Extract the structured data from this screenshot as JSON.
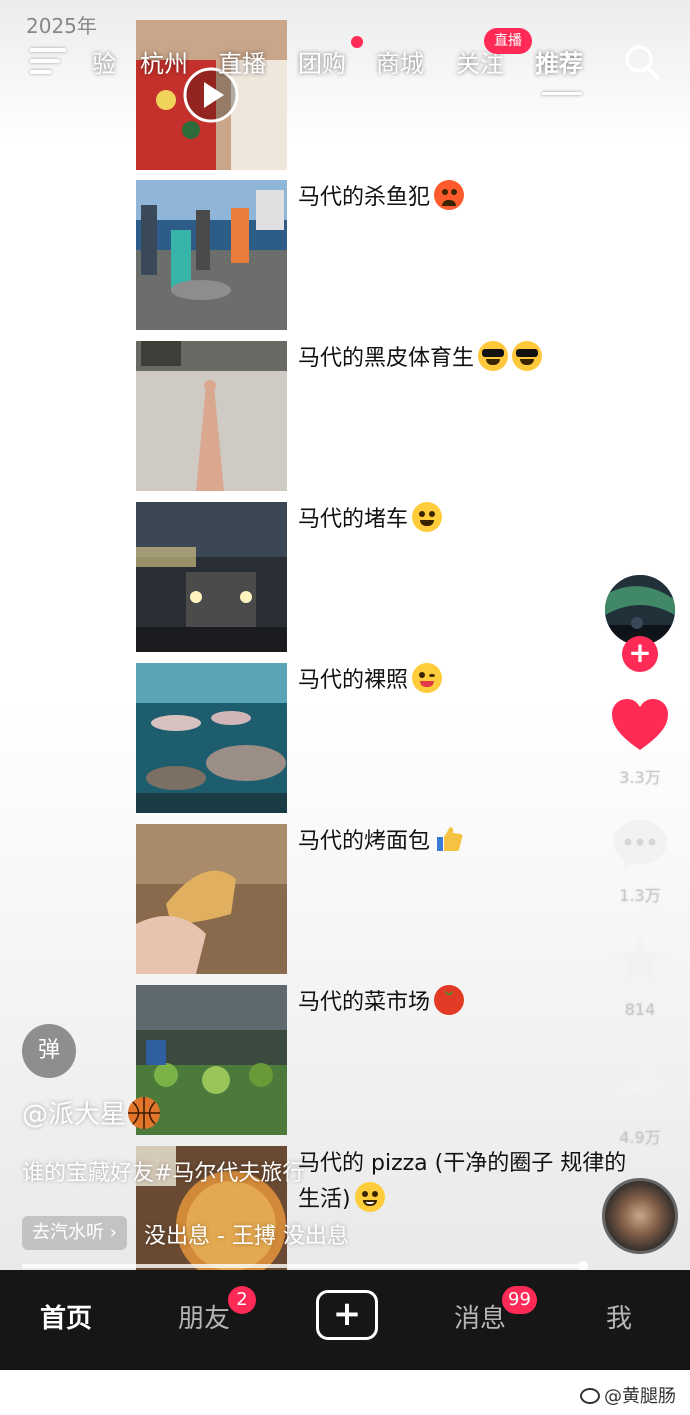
{
  "status": {
    "year": "2025年"
  },
  "topnav": {
    "tabs": [
      "验",
      "杭州",
      "直播",
      "团购",
      "商城",
      "关注",
      "推荐"
    ],
    "live_badge": "直播",
    "icons": {
      "menu": "menu-icon",
      "search": "search-icon"
    }
  },
  "list": [
    {
      "caption": "",
      "emoji": ""
    },
    {
      "caption": "马代的杀鱼犯",
      "emoji": "angry"
    },
    {
      "caption": "马代的黑皮体育生",
      "emoji": "cool-cool"
    },
    {
      "caption": "马代的堵车",
      "emoji": "laugh"
    },
    {
      "caption": "马代的裸照",
      "emoji": "wink"
    },
    {
      "caption": "马代的烤面包",
      "emoji": "thumbs-up"
    },
    {
      "caption": "马代的菜市场",
      "emoji": "tomato"
    },
    {
      "caption": "马代的 pizza (干净的圈子 规律的生活)",
      "emoji": "grin"
    }
  ],
  "rail": {
    "likes": "3.3万",
    "comments": "1.3万",
    "favorites": "814",
    "shares": "4.9万",
    "follow_symbol": "+"
  },
  "post": {
    "danmu_label": "弹",
    "author": "@派大星",
    "description": "谁的宝藏好友#马尔代夫旅行",
    "music_chip": "去汽水听 ›",
    "music_text": "没出息 - 王搏   没出息"
  },
  "bottom_nav": {
    "home": "首页",
    "friends": "朋友",
    "friends_badge": "2",
    "create_symbol": "+",
    "messages": "消息",
    "messages_badge": "99",
    "me": "我"
  },
  "watermark": "@黄腿肠",
  "colors": {
    "accent": "#ff2a55",
    "like": "#ff2b54",
    "bar": "#161616"
  }
}
